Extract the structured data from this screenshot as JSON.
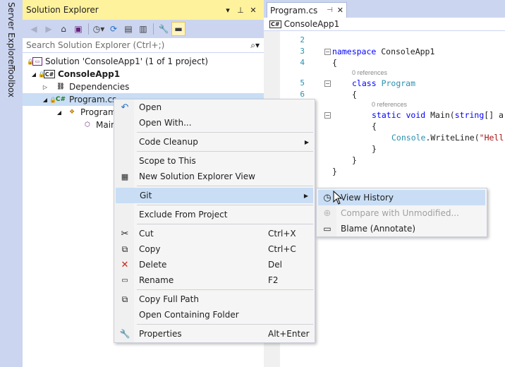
{
  "side_tabs": {
    "server_explorer": "Server Explorer",
    "toolbox": "Toolbox"
  },
  "solution_explorer": {
    "title": "Solution Explorer",
    "search_placeholder": "Search Solution Explorer (Ctrl+;)",
    "tree": [
      {
        "label": "Solution 'ConsoleApp1' (1 of 1 project)",
        "icon": "solution-icon"
      },
      {
        "label": "ConsoleApp1",
        "icon": "csharp-project-icon",
        "bold": true
      },
      {
        "label": "Dependencies",
        "icon": "dependencies-icon"
      },
      {
        "label": "Program.cs",
        "icon": "csharp-file-icon",
        "selected": true
      },
      {
        "label": "Program",
        "icon": "class-icon"
      },
      {
        "label": "Main",
        "icon": "method-icon"
      }
    ]
  },
  "editor": {
    "tab_label": "Program.cs",
    "nav_project": "ConsoleApp1",
    "line_numbers": [
      "2",
      "3",
      "4",
      "5",
      "6"
    ],
    "ref_a": "0 references",
    "ref_b": "0 references",
    "kw_namespace": "namespace",
    "ns_name": " ConsoleApp1",
    "brace_open": "{",
    "brace_close": "}",
    "kw_class": "class",
    "class_name": "Program",
    "kw_static": "static",
    "kw_void": "void",
    "main_sig": " Main(",
    "kw_string": "string",
    "main_args": "[] a",
    "console": "Console",
    "writeline": ".WriteLine(",
    "str_hello": "\"Hell"
  },
  "context_menu": {
    "items": [
      {
        "label": "Open",
        "icon": "open-arrow-icon"
      },
      {
        "label": "Open With..."
      },
      {
        "label": "Code Cleanup",
        "submenu": true
      },
      {
        "label": "Scope to This"
      },
      {
        "label": "New Solution Explorer View",
        "icon": "new-view-icon"
      },
      {
        "label": "Git",
        "submenu": true,
        "highlighted": true
      },
      {
        "label": "Exclude From Project"
      },
      {
        "label": "Cut",
        "shortcut": "Ctrl+X",
        "icon": "scissors-icon"
      },
      {
        "label": "Copy",
        "shortcut": "Ctrl+C",
        "icon": "copy-icon"
      },
      {
        "label": "Delete",
        "shortcut": "Del",
        "icon": "delete-x-icon"
      },
      {
        "label": "Rename",
        "shortcut": "F2",
        "icon": "rename-icon"
      },
      {
        "label": "Copy Full Path",
        "icon": "copy-path-icon"
      },
      {
        "label": "Open Containing Folder"
      },
      {
        "label": "Properties",
        "shortcut": "Alt+Enter",
        "icon": "wrench-icon"
      }
    ]
  },
  "git_submenu": {
    "items": [
      {
        "label": "View History",
        "icon": "history-icon",
        "highlighted": true
      },
      {
        "label": "Compare with Unmodified...",
        "icon": "compare-icon",
        "disabled": true
      },
      {
        "label": "Blame (Annotate)",
        "icon": "comment-icon"
      }
    ]
  },
  "colors": {
    "accent_title": "#FFF29D",
    "chrome": "#CCD5F0",
    "highlight": "#C9DEF5"
  }
}
